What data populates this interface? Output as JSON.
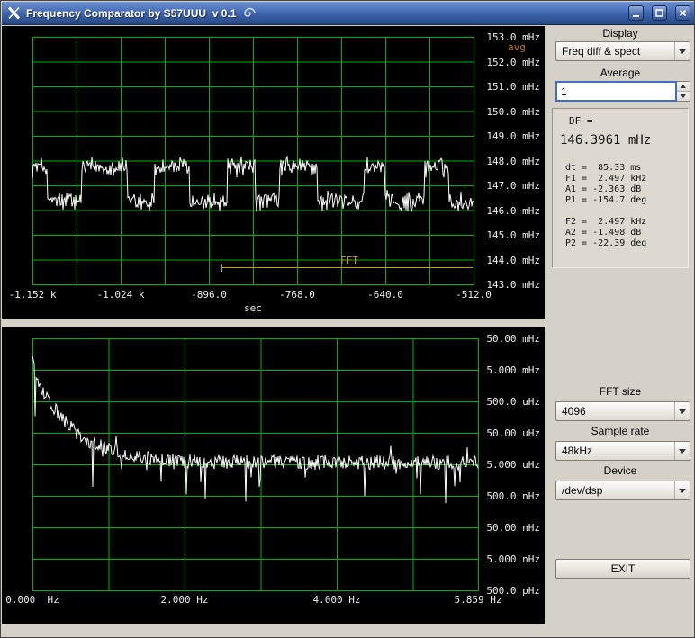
{
  "window": {
    "title": "Frequency Comparator by S57UUU  v 0.1"
  },
  "colors": {
    "grid": "#00b400",
    "trace": "#ffffff",
    "marker": "#c8a000"
  },
  "top_plot": {
    "avg_label": "avg",
    "fft_label": "FFT",
    "x_axis_label": "sec",
    "y_ticks": [
      "153.0 mHz",
      "152.0 mHz",
      "151.0 mHz",
      "150.0 mHz",
      "149.0 mHz",
      "148.0 mHz",
      "147.0 mHz",
      "146.0 mHz",
      "145.0 mHz",
      "144.0 mHz",
      "143.0 mHz"
    ],
    "x_ticks": [
      "-1.152 k",
      "-1.024 k",
      "-896.0",
      "-768.0",
      "-640.0",
      "-512.0"
    ]
  },
  "bottom_plot": {
    "y_ticks": [
      "50.00 mHz",
      "5.000 mHz",
      "500.0 uHz",
      "50.00 uHz",
      "5.000 uHz",
      "500.0 nHz",
      "50.00 nHz",
      "5.000 nHz",
      "500.0 pHz"
    ],
    "x_ticks": [
      "0.000  Hz",
      "2.000 Hz",
      "4.000 Hz",
      "5.859 Hz"
    ]
  },
  "sidebar": {
    "display_label": "Display",
    "display_value": "Freq diff & spect",
    "average_label": "Average",
    "average_value": "1",
    "readout": {
      "df_label": "DF =",
      "df_value": "146.3961 mHz",
      "lines": [
        "dt =  85.33 ms",
        "F1 =  2.497 kHz",
        "A1 = -2.363 dB",
        "P1 = -154.7 deg",
        "",
        "F2 =  2.497 kHz",
        "A2 = -1.498 dB",
        "P2 = -22.39 deg"
      ]
    },
    "fft_size_label": "FFT size",
    "fft_size_value": "4096",
    "sample_rate_label": "Sample rate",
    "sample_rate_value": "48kHz",
    "device_label": "Device",
    "device_value": "/dev/dsp",
    "exit_label": "EXIT"
  }
}
